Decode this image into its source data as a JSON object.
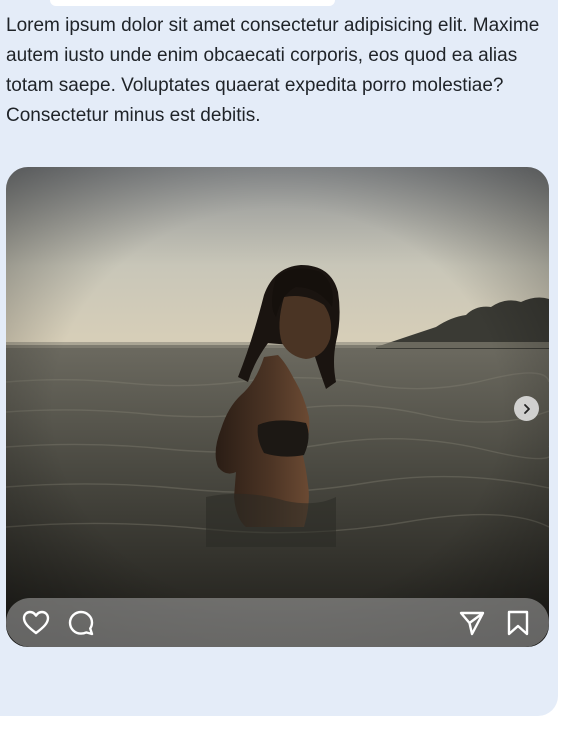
{
  "post": {
    "caption": "Lorem ipsum dolor sit amet consectetur adipisicing elit. Maxime autem iusto unde enim obcaecati corporis, eos quod ea alias totam saepe. Voluptates quaerat expedita porro molestiae? Consectetur minus est debitis."
  },
  "icons": {
    "next": "chevron-right-icon",
    "like": "heart-icon",
    "comment": "comment-icon",
    "share": "send-icon",
    "save": "bookmark-icon"
  },
  "colors": {
    "card_background": "#e4ecf8",
    "text": "#1f2328"
  }
}
